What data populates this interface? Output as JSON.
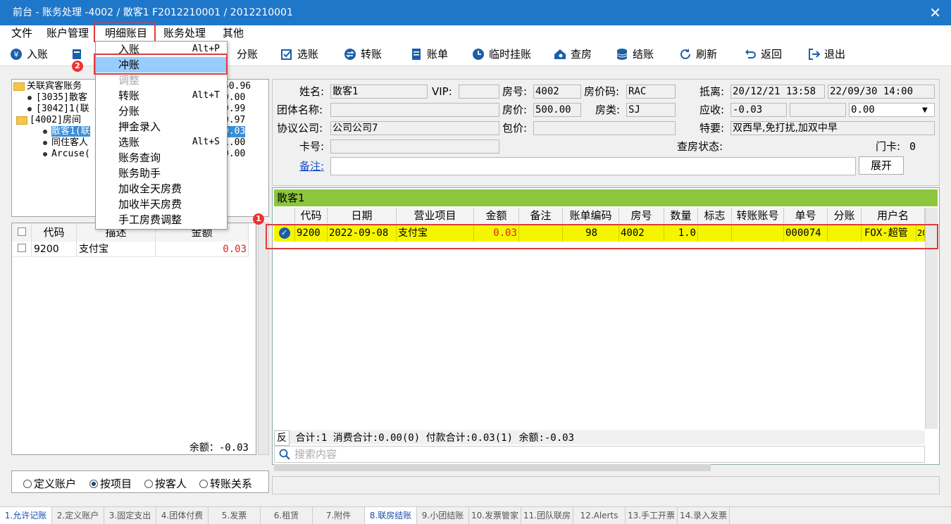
{
  "window": {
    "title": "前台 - 账务处理 -4002 / 散客1 F2012210001 / 2012210001",
    "close_glyph": "✕"
  },
  "menu": [
    "文件",
    "账户管理",
    "明细账目",
    "账务处理",
    "其他"
  ],
  "toolbar": {
    "items": [
      {
        "label": "入账",
        "icon": "yen-icon"
      },
      {
        "label": "入账",
        "icon": "document-icon"
      },
      {
        "label": "分账",
        "icon": "split-icon"
      },
      {
        "label": "选账",
        "icon": "checkbox-icon"
      },
      {
        "label": "转账",
        "icon": "transfer-icon"
      },
      {
        "label": "账单",
        "icon": "bill-icon"
      },
      {
        "label": "临时挂账",
        "icon": "clock-icon"
      },
      {
        "label": "查房",
        "icon": "house-search-icon"
      },
      {
        "label": "结账",
        "icon": "database-icon"
      },
      {
        "label": "刷新",
        "icon": "refresh-icon"
      },
      {
        "label": "返回",
        "icon": "back-icon"
      },
      {
        "label": "退出",
        "icon": "exit-icon"
      }
    ]
  },
  "dropdown": {
    "items": [
      {
        "label": "入账",
        "shortcut": "Alt+P"
      },
      {
        "label": "冲账",
        "shortcut": ""
      },
      {
        "label": "调整",
        "shortcut": ""
      },
      {
        "label": "转账",
        "shortcut": "Alt+T"
      },
      {
        "label": "分账",
        "shortcut": ""
      },
      {
        "label": "押金录入",
        "shortcut": ""
      },
      {
        "label": "选账",
        "shortcut": "Alt+S"
      },
      {
        "label": "账务查询",
        "shortcut": ""
      },
      {
        "label": "账务助手",
        "shortcut": ""
      },
      {
        "label": "加收全天房费",
        "shortcut": ""
      },
      {
        "label": "加收半天房费",
        "shortcut": ""
      },
      {
        "label": "手工房费调整",
        "shortcut": ""
      }
    ]
  },
  "badges": {
    "one": "1",
    "two": "2"
  },
  "tree": {
    "items": [
      {
        "label": "关联宾客账务",
        "value": "50.96"
      },
      {
        "label": "[3035]散客",
        "value": "0.00"
      },
      {
        "label": "[3042]1(联",
        "value": "9.99"
      },
      {
        "label": "[4002]房间",
        "value": "0.97"
      },
      {
        "label": "散客1(联",
        "value": "0.03"
      },
      {
        "label": "同住客人",
        "value": "1.00"
      },
      {
        "label": "Arcuse(",
        "value": "0.00"
      }
    ]
  },
  "lefttable": {
    "headers": [
      "代码",
      "描述",
      "金额"
    ],
    "rows": [
      {
        "code": "9200",
        "desc": "支付宝",
        "amount": "0.03"
      }
    ],
    "balance": "余额：-0.03"
  },
  "radios": {
    "items": [
      "定义账户",
      "按项目",
      "按客人",
      "转账关系"
    ],
    "selected": "按项目"
  },
  "info": {
    "name_label": "姓名:",
    "name": "散客1",
    "vip_label": "VIP:",
    "vip": "",
    "room_label": "房号:",
    "room": "4002",
    "ratecode_label": "房价码:",
    "ratecode": "RAC",
    "arrive_label": "抵离:",
    "arrive": "20/12/21 13:58",
    "depart": "22/09/30 14:00",
    "group_label": "团体名称:",
    "group": "",
    "price_label": "房价:",
    "price": "500.00",
    "roomtype_label": "房类:",
    "roomtype": "SJ",
    "due_label": "应收:",
    "due": "-0.03",
    "due2": "",
    "due3": "0.00",
    "company_label": "协议公司:",
    "company": "公司公司7",
    "package_label": "包价:",
    "package": "",
    "special_label": "特要:",
    "special": "双西早,免打扰,加双中早",
    "card_label": "卡号:",
    "card": "",
    "checkstatus_label": "查房状态:",
    "doorcard_label": "门卡:",
    "doorcard": "0",
    "remark_label": "备注:",
    "remark": "",
    "expand_label": "展开"
  },
  "grid": {
    "guest": "散客1",
    "headers": [
      "代码",
      "日期",
      "营业项目",
      "金额",
      "备注",
      "账单编码",
      "房号",
      "数量",
      "标志",
      "转账账号",
      "单号",
      "分账",
      "用户名"
    ],
    "row": {
      "code": "9200",
      "date": "2022-09-08",
      "item": "支付宝",
      "amount": "0.03",
      "remark": "",
      "billcode": "98",
      "room": "4002",
      "qty": "1.0",
      "flag": "",
      "transfer": "",
      "order": "000074",
      "split": "",
      "user": "FOX-超管",
      "extra": "20"
    },
    "summary": {
      "reverse": "反",
      "text": "合计:1  消费合计:0.00(0)  付款合计:0.03(1)  余额:-0.03"
    },
    "search_placeholder": "搜索内容"
  },
  "tabs": [
    "1.允许记账",
    "2.定义账户",
    "3.固定支出",
    "4.团体付费",
    "5.发票",
    "6.租赁",
    "7.附件",
    "8.联房结账",
    "9.小团结账",
    "10.发票管家",
    "11.团队联房",
    "12.Alerts",
    "13.手工开票",
    "14.录入发票"
  ],
  "colors": {
    "title_bg": "#1f77c9",
    "highlight": "#f5f500",
    "guest_bar": "#8cc63f",
    "red": "#e02020",
    "selected_menu": "#99ccff"
  }
}
